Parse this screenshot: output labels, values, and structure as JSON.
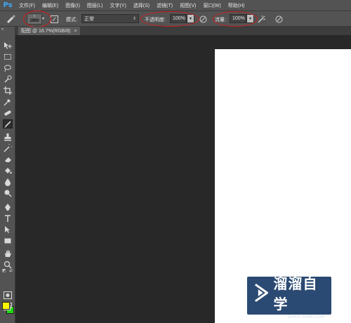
{
  "app": {
    "logo": "Ps"
  },
  "menu": [
    {
      "label": "文件(F)"
    },
    {
      "label": "编辑(E)"
    },
    {
      "label": "图像(I)"
    },
    {
      "label": "图层(L)"
    },
    {
      "label": "文字(Y)"
    },
    {
      "label": "选择(S)"
    },
    {
      "label": "滤镜(T)"
    },
    {
      "label": "视图(V)"
    },
    {
      "label": "窗口(W)"
    },
    {
      "label": "帮助(H)"
    }
  ],
  "options": {
    "brush_size": "1900",
    "mode_label": "模式:",
    "mode_value": "正常",
    "opacity_label": "不透明度:",
    "opacity_value": "100%",
    "flow_label": "流量:",
    "flow_value": "100%"
  },
  "document": {
    "tab_title": "配图 @ 16.7%(RGB/8)",
    "close_glyph": "×"
  },
  "colors": {
    "foreground": "#fff600",
    "background": "#1fd60f",
    "highlight_ellipse": "#d21b1b"
  },
  "watermark": {
    "title": "溜溜自学",
    "url": "ZIXUE.3D66.COM"
  },
  "tools": [
    "move-icon",
    "marquee-icon",
    "lasso-icon",
    "quick-select-icon",
    "crop-icon",
    "eyedropper-icon",
    "healing-brush-icon",
    "brush-icon",
    "clone-stamp-icon",
    "history-brush-icon",
    "eraser-icon",
    "paint-bucket-icon",
    "blur-icon",
    "dodge-icon",
    "pen-icon",
    "type-icon",
    "path-select-icon",
    "rectangle-icon",
    "hand-icon",
    "zoom-icon"
  ]
}
